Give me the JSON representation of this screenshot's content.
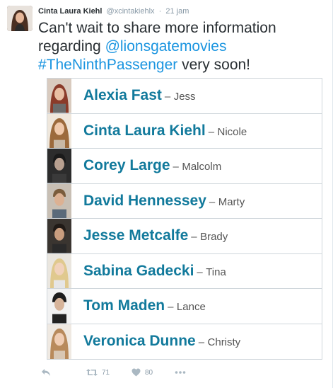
{
  "tweet": {
    "author_name": "Cinta Laura Kiehl",
    "author_handle": "@xcintakiehlx",
    "separator": "·",
    "timestamp": "21 jam",
    "text_start": "Can't wait to share more information regarding ",
    "mention": "@lionsgatemovies",
    "hashtag": "#TheNinthPassenger",
    "text_end": " very soon!"
  },
  "cast_list": [
    {
      "actor": "Alexia Fast",
      "role": "Jess"
    },
    {
      "actor": "Cinta Laura Kiehl",
      "role": "Nicole"
    },
    {
      "actor": "Corey Large",
      "role": "Malcolm"
    },
    {
      "actor": "David Hennessey",
      "role": "Marty"
    },
    {
      "actor": "Jesse Metcalfe",
      "role": "Brady"
    },
    {
      "actor": "Sabina Gadecki",
      "role": "Tina"
    },
    {
      "actor": "Tom Maden",
      "role": "Lance"
    },
    {
      "actor": "Veronica Dunne",
      "role": "Christy"
    }
  ],
  "cast_dash": "–",
  "actions": {
    "retweet_count": "71",
    "like_count": "80"
  },
  "icons": {
    "reply": "reply-icon",
    "retweet": "retweet-icon",
    "like": "heart-icon",
    "more": "more-icon"
  }
}
